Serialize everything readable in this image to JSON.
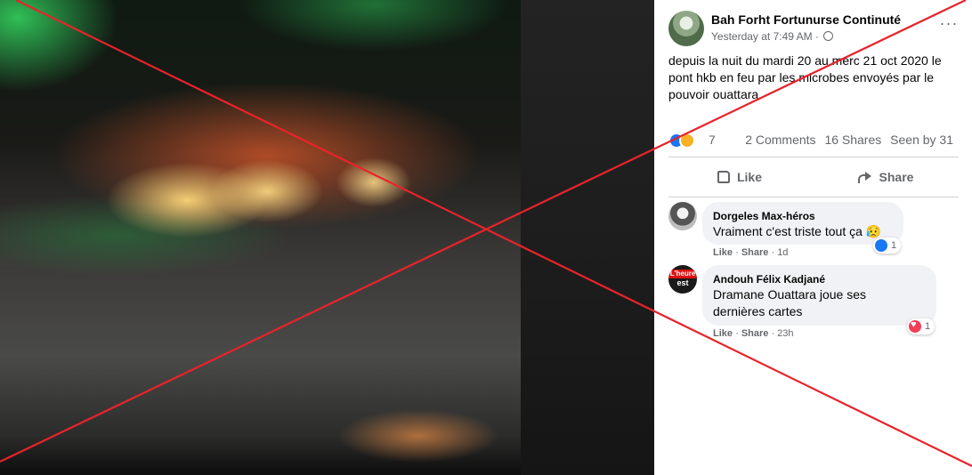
{
  "post": {
    "author": "Bah Forht Fortunurse Continuté",
    "timestamp": "Yesterday at 7:49 AM",
    "meta_separator": "·",
    "more": "···",
    "text": "depuis la nuit du mardi 20 au merc 21 oct 2020 le pont hkb en feu par les microbes envoyés par le pouvoir ouattara",
    "reaction_count": "7",
    "comments_count": "2 Comments",
    "shares_count": "16 Shares",
    "seen_by": "Seen by 31",
    "like_label": "Like",
    "share_label": "Share"
  },
  "comments": [
    {
      "name": "Dorgeles Max-héros",
      "text": "Vraiment c'est triste tout ça 😥",
      "like": "Like",
      "share": "Share",
      "sep": "·",
      "age": "1d",
      "reaction_count": "1"
    },
    {
      "name": "Andouh Félix Kadjané",
      "text": "Dramane Ouattara joue ses dernières cartes",
      "like": "Like",
      "share": "Share",
      "sep": "·",
      "age": "23h",
      "reaction_count": "1",
      "avatar_text_top": "L'heure",
      "avatar_text_bottom": "est"
    }
  ],
  "overlay": {
    "color": "#e8232a"
  }
}
